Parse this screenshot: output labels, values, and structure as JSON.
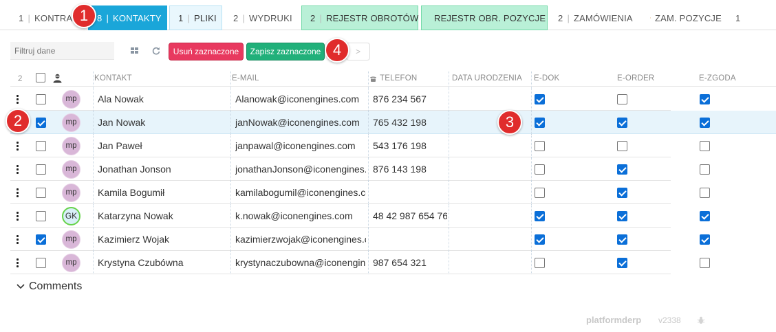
{
  "tabs": [
    {
      "count": "1",
      "label": "KONTRAH"
    },
    {
      "count": "8",
      "label": "KONTAKTY"
    },
    {
      "count": "1",
      "label": "PLIKI"
    },
    {
      "count": "2",
      "label": "WYDRUKI"
    },
    {
      "count": "2",
      "label": "REJESTR OBROTÓW"
    },
    {
      "count": "",
      "label": "REJESTR OBR. POZYCJE"
    },
    {
      "count": "2",
      "label": "ZAMÓWIENIA"
    },
    {
      "count": "",
      "label": "ZAM. POZYCJE"
    },
    {
      "count": "1",
      "label": ""
    }
  ],
  "toolbar": {
    "filter_placeholder": "Filtruj dane",
    "delete_label": "Usuń zaznaczone",
    "save_label": "Zapisz zaznaczone",
    "ghost_label": ">"
  },
  "table": {
    "selected_count": "2",
    "headers": {
      "contact": "KONTAKT",
      "email": "E-MAIL",
      "phone": "TELEFON",
      "dob": "DATA URODZENIA",
      "edok": "E-DOK",
      "eorder": "E-ORDER",
      "ezgoda": "E-ZGODA"
    },
    "rows": [
      {
        "selected": false,
        "avatar": "mp",
        "name": "Ala Nowak",
        "email": "Alanowak@iconengines.com",
        "phone": "876 234 567",
        "dob": "",
        "edok": true,
        "eorder": false,
        "ezgoda": true
      },
      {
        "selected": true,
        "avatar": "mp",
        "name": "Jan Nowak",
        "email": "janNowak@iconengines.com",
        "phone": "765 432 198",
        "dob": "",
        "edok": true,
        "eorder": true,
        "ezgoda": true
      },
      {
        "selected": false,
        "avatar": "mp",
        "name": "Jan Paweł",
        "email": "janpawal@iconengines.com",
        "phone": "543 176 198",
        "dob": "",
        "edok": false,
        "eorder": false,
        "ezgoda": false
      },
      {
        "selected": false,
        "avatar": "mp",
        "name": "Jonathan Jonson",
        "email": "jonathanJonson@iconengines.com",
        "phone": "876 143 198",
        "dob": "",
        "edok": false,
        "eorder": true,
        "ezgoda": false
      },
      {
        "selected": false,
        "avatar": "mp",
        "name": "Kamila Bogumił",
        "email": "kamilabogumil@iconengines.com",
        "phone": "",
        "dob": "",
        "edok": false,
        "eorder": true,
        "ezgoda": false
      },
      {
        "selected": false,
        "avatar": "GK",
        "name": "Katarzyna Nowak",
        "email": "k.nowak@iconengines.com",
        "phone": "48 42 987 654 76",
        "dob": "",
        "edok": true,
        "eorder": true,
        "ezgoda": true
      },
      {
        "selected": true,
        "avatar": "mp",
        "name": "Kazimierz Wojak",
        "email": "kazimierzwojak@iconengines.com",
        "phone": "",
        "dob": "",
        "edok": true,
        "eorder": true,
        "ezgoda": true
      },
      {
        "selected": false,
        "avatar": "mp",
        "name": "Krystyna Czubówna",
        "email": "krystynaczubowna@iconengines.com",
        "phone": "987 654 321",
        "dob": "",
        "edok": false,
        "eorder": true,
        "ezgoda": false
      }
    ]
  },
  "badges": [
    "1",
    "2",
    "3",
    "4"
  ],
  "footer": {
    "comments_label": "Comments",
    "brand": "platformderp",
    "version": "v2338"
  },
  "colors": {
    "active_tab": "#1aa6d9",
    "delete_button": "#e8395f",
    "save_button": "#21b07a",
    "checkbox_on": "#0b6fd8",
    "badge": "#e02c2c",
    "selected_row": "#e7f4fb"
  },
  "icons": {
    "hourglass": "hourglass-icon",
    "view_toggle": "grid-view-icon",
    "refresh": "refresh-icon",
    "person": "person-icon",
    "chevron": "chevron-down-icon",
    "bug": "bug-icon"
  }
}
